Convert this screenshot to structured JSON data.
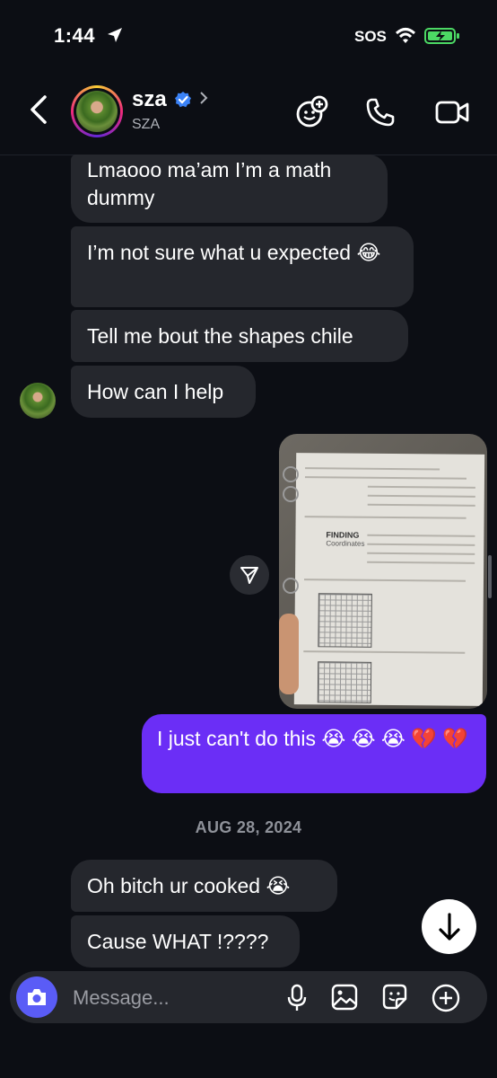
{
  "status_bar": {
    "time": "1:44",
    "carrier": "SOS"
  },
  "header": {
    "name": "sza",
    "handle": "SZA"
  },
  "messages": {
    "m1": "Lmaooo ma’am I’m a math dummy",
    "m2": "I’m not sure what u expected 😂",
    "m3": "Tell me bout the shapes chile",
    "m4": "How can I help",
    "mine": "I just can't do this 😭 😭 😭 💔 💔",
    "m5": "Oh bitch ur cooked 😭",
    "m6": "Cause WHAT !????"
  },
  "photo": {
    "heading": "FINDING",
    "subheading": "Coordinates"
  },
  "date_divider": "AUG 28, 2024",
  "composer": {
    "placeholder": "Message..."
  },
  "colors": {
    "background": "#0c0e14",
    "incoming_bubble": "#25272d",
    "outgoing_bubble": "#6b2ef6",
    "camera_button": "#5a5cf6",
    "verified": "#3b82f6"
  },
  "icons": [
    "location-arrow-icon",
    "wifi-icon",
    "battery-icon",
    "back-icon",
    "verified-icon",
    "chevron-right-icon",
    "effects-icon",
    "phone-icon",
    "video-icon",
    "share-icon",
    "arrow-down-icon",
    "camera-icon",
    "mic-icon",
    "gallery-icon",
    "sticker-icon",
    "plus-icon"
  ]
}
